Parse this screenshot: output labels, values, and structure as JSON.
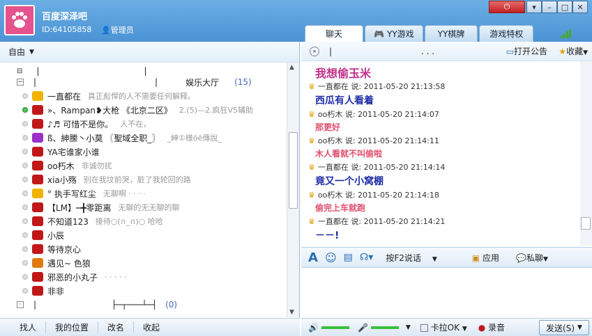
{
  "header": {
    "title": "百度深泽吧",
    "uid": "ID:64105858",
    "role": "管理员"
  },
  "tabs": [
    "聊天",
    "YY游戏",
    "YY棋牌",
    "游戏特权"
  ],
  "left": {
    "mode": "自由",
    "lobby": "娱乐大厅",
    "lobby_count": "(15)",
    "members": [
      {
        "name": "一直都在",
        "sig": "真正彪悍的人不需要任何解释。",
        "color": "#f0b400"
      },
      {
        "name": "»、Rampan❥大枪 《北京二区》",
        "sig": "2.(5)—2.疯狂V5辅助",
        "color": "#c01818"
      },
      {
        "name": "♪♬ 可惜不是你。",
        "sig": "人不在，",
        "color": "#c01818"
      },
      {
        "name": "ß、紳縢丶小莫 〖聖域全职_〗",
        "sig": "_紳①様ōē傳說_",
        "color": "#9b30c8"
      },
      {
        "name": "YA宅谁家小谁",
        "sig": "",
        "color": "#c01818"
      },
      {
        "name": "oo朽木",
        "sig": "非诚勿扰",
        "color": "#c01818"
      },
      {
        "name": "xia小殇",
        "sig": "别在我坟前哭，脏了我轮回的路",
        "color": "#c01818"
      },
      {
        "name": "° 执手写红尘",
        "sig": "无聊啊 · · · ·",
        "color": "#f0b400"
      },
      {
        "name": "【LM】┉╋零距离",
        "sig": "无聊的无无聊的聊",
        "color": "#c01818"
      },
      {
        "name": "不知道123",
        "sig": "接待○(∩_∩)○ 哈哈",
        "color": "#c01818"
      },
      {
        "name": "小辰",
        "sig": "",
        "color": "#c01818"
      },
      {
        "name": "等待京心",
        "sig": "",
        "color": "#c01818"
      },
      {
        "name": "遇见~ 色狼",
        "sig": "",
        "color": "#e07a10"
      },
      {
        "name": "邪恶的小丸子",
        "sig": "· · · · ·",
        "color": "#c01818"
      },
      {
        "name": "非非",
        "sig": "",
        "color": "#c01818"
      }
    ],
    "bottom_count": "(0)",
    "bottom_buttons": [
      "找人",
      "我的位置",
      "改名",
      "收起"
    ]
  },
  "right": {
    "announce": "打开公告",
    "collect": "收藏",
    "messages": [
      {
        "type": "text",
        "text": "我想偷玉米",
        "color": "#c0308a",
        "size": 16
      },
      {
        "type": "meta",
        "text": "一直都在 说: 2011-05-20 21:13:58"
      },
      {
        "type": "text",
        "text": "西瓜有人看着",
        "color": "#1f2ea8",
        "size": 14
      },
      {
        "type": "meta",
        "text": "oo朽木 说: 2011-05-20 21:14:07"
      },
      {
        "type": "text",
        "text": "那更好",
        "color": "#e0506e",
        "size": 12
      },
      {
        "type": "meta",
        "text": "oo朽木 说: 2011-05-20 21:14:11"
      },
      {
        "type": "text",
        "text": "木人看就不叫偷啦",
        "color": "#e0506e",
        "size": 12
      },
      {
        "type": "meta",
        "text": "一直都在 说: 2011-05-20 21:14:14"
      },
      {
        "type": "text",
        "text": "竟又一个小窝棚",
        "color": "#1f2ea8",
        "size": 14
      },
      {
        "type": "meta",
        "text": "oo朽木 说: 2011-05-20 21:14:18"
      },
      {
        "type": "text",
        "text": "偷完上车就跑",
        "color": "#e0506e",
        "size": 12
      },
      {
        "type": "meta",
        "text": "一直都在 说: 2011-05-20 21:14:21"
      },
      {
        "type": "text",
        "text": "－－!",
        "color": "#1f2ea8",
        "size": 14
      }
    ],
    "toolbar": {
      "speak": "按F2说话",
      "app": "应用",
      "private": "私聊"
    },
    "bottom": {
      "karaoke": "卡拉OK",
      "record": "录音",
      "send": "发送(S)"
    }
  }
}
